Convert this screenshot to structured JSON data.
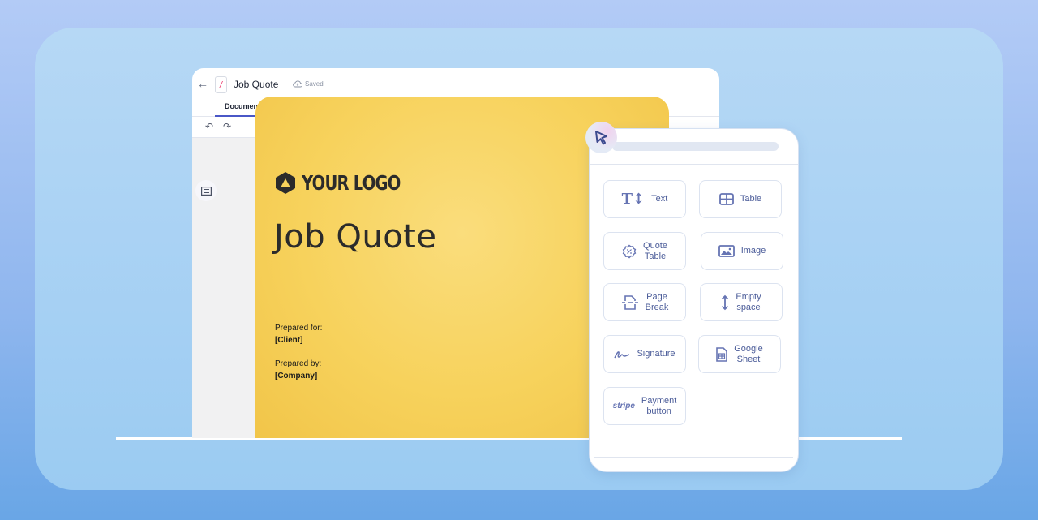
{
  "editor": {
    "title": "Job Quote",
    "save_status": "Saved",
    "tabs": [
      {
        "label": "Documen"
      }
    ],
    "icons": {
      "back": "arrow-left-icon",
      "undo": "undo-icon",
      "redo": "redo-icon",
      "outline": "list-outline-icon",
      "cloud": "cloud-upload-icon"
    }
  },
  "page": {
    "logo_text": "YOUR LOGO",
    "title": "Job Quote",
    "prepared_for_label": "Prepared for:",
    "prepared_for_value": "[Client]",
    "prepared_by_label": "Prepared by:",
    "prepared_by_value": "[Company]",
    "background_color": "#f7d25c"
  },
  "panel": {
    "blocks": [
      {
        "label": "Text",
        "icon": "text-size-icon"
      },
      {
        "label": "Table",
        "icon": "table-icon"
      },
      {
        "label": "Quote Table",
        "line1": "Quote",
        "line2": "Table",
        "icon": "quote-badge-icon"
      },
      {
        "label": "Image",
        "icon": "image-icon"
      },
      {
        "label": "Page Break",
        "line1": "Page",
        "line2": "Break",
        "icon": "page-break-icon"
      },
      {
        "label": "Empty space",
        "line1": "Empty",
        "line2": "space",
        "icon": "vertical-arrows-icon"
      },
      {
        "label": "Signature",
        "icon": "signature-icon"
      },
      {
        "label": "Google Sheet",
        "line1": "Google",
        "line2": "Sheet",
        "icon": "sheet-icon"
      },
      {
        "label": "Payment button",
        "line1": "Payment",
        "line2": "button",
        "icon": "stripe-logo",
        "icon_text": "stripe"
      }
    ],
    "accent_color": "#4b5c99"
  }
}
